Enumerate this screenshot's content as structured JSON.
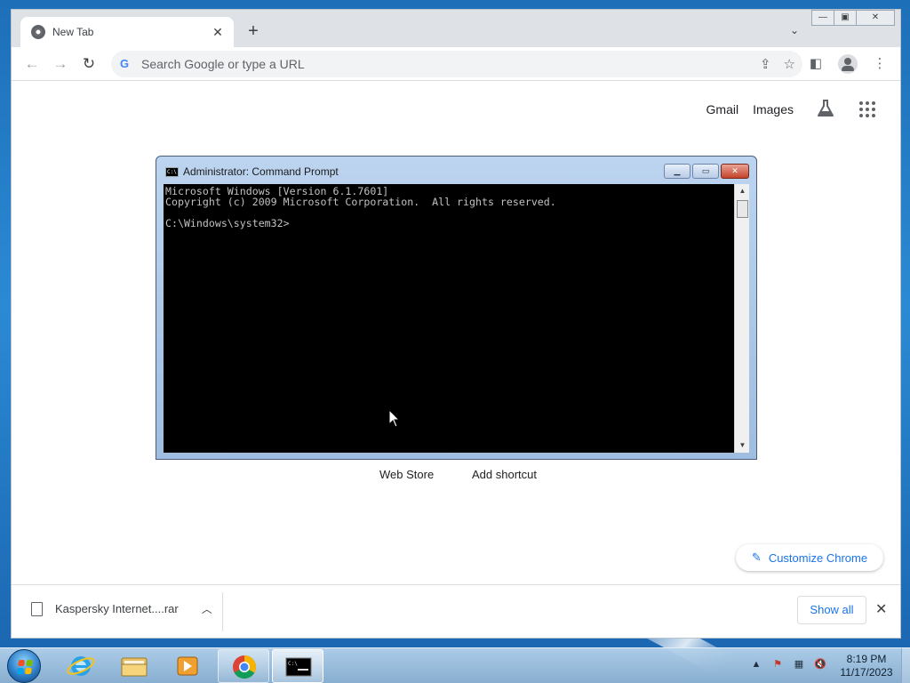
{
  "browser": {
    "tab_title": "New Tab",
    "omnibox_placeholder": "Search Google or type a URL"
  },
  "ntp": {
    "gmail": "Gmail",
    "images": "Images",
    "shortcuts": [
      "Web Store",
      "Add shortcut"
    ],
    "customize": "Customize Chrome"
  },
  "cmd": {
    "title": "Administrator:  Command Prompt",
    "line1": "Microsoft Windows [Version 6.1.7601]",
    "line2": "Copyright (c) 2009 Microsoft Corporation.  All rights reserved.",
    "line3": "",
    "line4": "C:\\Windows\\system32>"
  },
  "downloads": {
    "file_name": "Kaspersky Internet....rar",
    "show_all": "Show all"
  },
  "taskbar": {
    "time": "8:19 PM",
    "date": "11/17/2023"
  },
  "colors": {
    "accent": "#1a73e8",
    "console_bg": "#000000",
    "console_text": "#c0c0c0"
  }
}
